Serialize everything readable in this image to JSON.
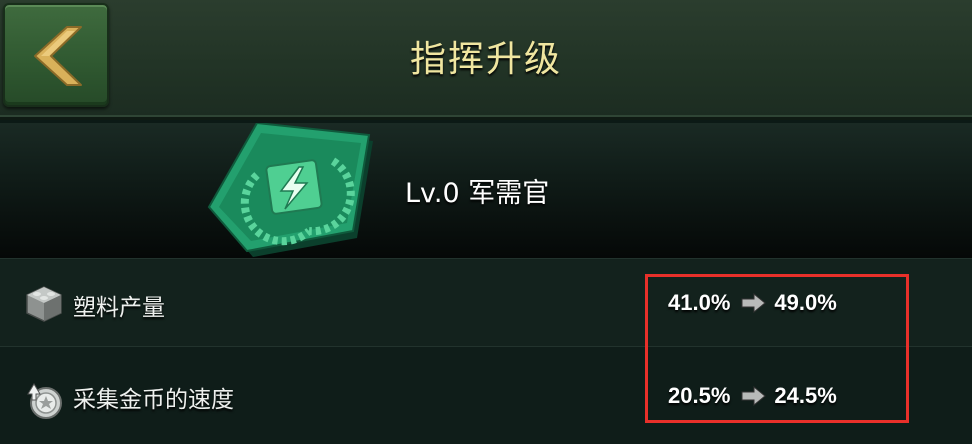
{
  "header": {
    "back_icon": "chevron-left-icon",
    "title": "指挥升级"
  },
  "hero": {
    "badge_icon": "lightning-laurel-badge-icon",
    "level_text": "Lv.0 军需官"
  },
  "stats": [
    {
      "icon": "plastic-block-icon",
      "label": "塑料产量",
      "from": "41.0%",
      "to": "49.0%"
    },
    {
      "icon": "coin-gather-icon",
      "label": "采集金币的速度",
      "from": "20.5%",
      "to": "24.5%"
    }
  ],
  "colors": {
    "title": "#f0e6a0",
    "highlight_border": "#e8302a",
    "back_button": "#2f5830"
  }
}
